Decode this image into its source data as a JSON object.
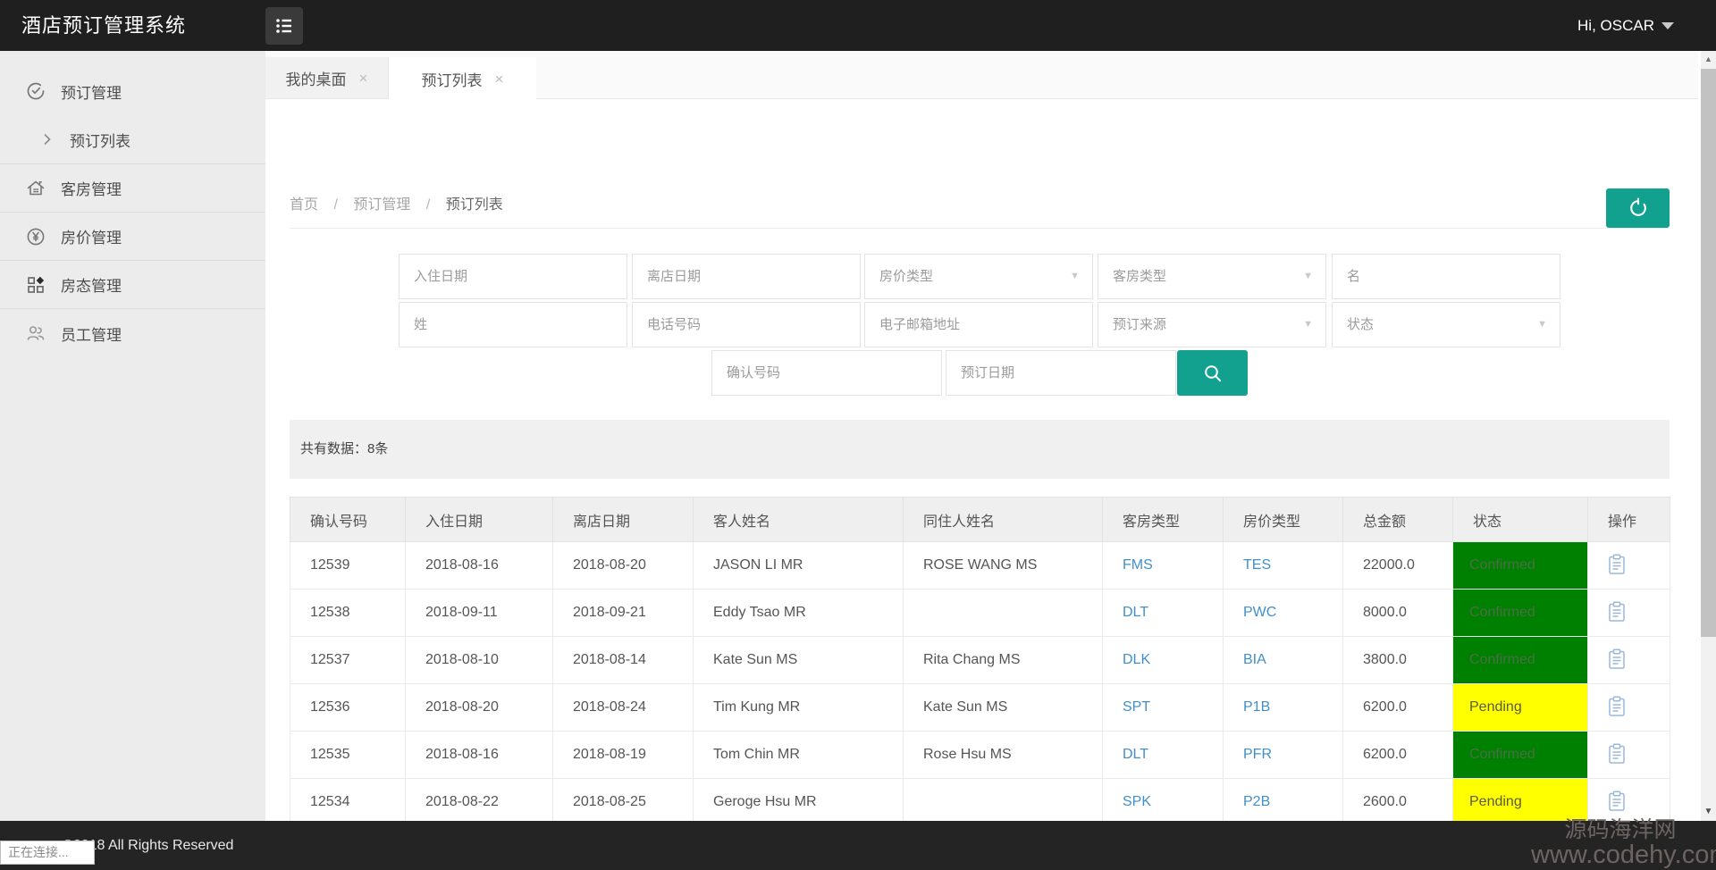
{
  "app": {
    "title": "酒店预订管理系统",
    "user": "Hi, OSCAR"
  },
  "tabs": [
    {
      "label": "我的桌面"
    },
    {
      "label": "预订列表"
    }
  ],
  "sidebar": {
    "items": [
      {
        "label": "预订管理"
      },
      {
        "label": "预订列表"
      },
      {
        "label": "客房管理"
      },
      {
        "label": "房价管理"
      },
      {
        "label": "房态管理"
      },
      {
        "label": "员工管理"
      }
    ]
  },
  "breadcrumb": {
    "home": "首页",
    "section": "预订管理",
    "current": "预订列表",
    "separator": "/"
  },
  "filters": {
    "checkin": "入住日期",
    "checkout": "离店日期",
    "rate_type": "房价类型",
    "room_type": "客房类型",
    "first_name": "名",
    "last_name": "姓",
    "phone": "电话号码",
    "email": "电子邮箱地址",
    "source": "预订来源",
    "status": "状态",
    "confirm_no": "确认号码",
    "booking_date": "预订日期"
  },
  "summary": {
    "text": "共有数据：8条"
  },
  "table": {
    "headers": [
      "确认号码",
      "入住日期",
      "离店日期",
      "客人姓名",
      "同住人姓名",
      "客房类型",
      "房价类型",
      "总金额",
      "状态",
      "操作"
    ],
    "rows": [
      {
        "confirm_no": "12539",
        "checkin": "2018-08-16",
        "checkout": "2018-08-20",
        "guest": "JASON LI MR",
        "companion": "ROSE WANG MS",
        "room_type": "FMS",
        "rate_type": "TES",
        "amount": "22000.0",
        "status": "Confirmed"
      },
      {
        "confirm_no": "12538",
        "checkin": "2018-09-11",
        "checkout": "2018-09-21",
        "guest": "Eddy Tsao MR",
        "companion": "",
        "room_type": "DLT",
        "rate_type": "PWC",
        "amount": "8000.0",
        "status": "Confirmed"
      },
      {
        "confirm_no": "12537",
        "checkin": "2018-08-10",
        "checkout": "2018-08-14",
        "guest": "Kate Sun MS",
        "companion": "Rita Chang MS",
        "room_type": "DLK",
        "rate_type": "BIA",
        "amount": "3800.0",
        "status": "Confirmed"
      },
      {
        "confirm_no": "12536",
        "checkin": "2018-08-20",
        "checkout": "2018-08-24",
        "guest": "Tim Kung MR",
        "companion": "Kate Sun MS",
        "room_type": "SPT",
        "rate_type": "P1B",
        "amount": "6200.0",
        "status": "Pending"
      },
      {
        "confirm_no": "12535",
        "checkin": "2018-08-16",
        "checkout": "2018-08-19",
        "guest": "Tom Chin MR",
        "companion": "Rose Hsu MS",
        "room_type": "DLT",
        "rate_type": "PFR",
        "amount": "6200.0",
        "status": "Confirmed"
      },
      {
        "confirm_no": "12534",
        "checkin": "2018-08-22",
        "checkout": "2018-08-25",
        "guest": "Geroge Hsu MR",
        "companion": "",
        "room_type": "SPK",
        "rate_type": "P2B",
        "amount": "2600.0",
        "status": "Pending"
      }
    ]
  },
  "footer": {
    "copyright": "©2018 All Rights Reserved",
    "status_tooltip": "正在连接...",
    "watermark_line1": "源码海洋网",
    "watermark_line2": "www.codehy.com"
  },
  "colors": {
    "accent_teal": "#12a08f",
    "confirmed_green": "#008000",
    "pending_yellow": "#ffff00",
    "link_blue": "#418fc8",
    "header_dark": "#1f1f1f"
  }
}
